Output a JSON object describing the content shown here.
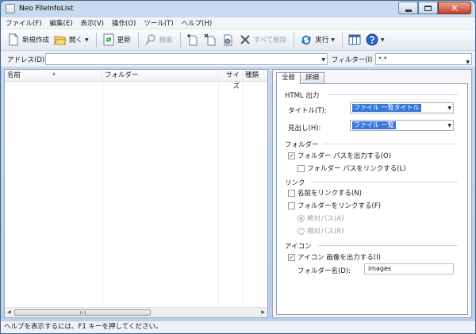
{
  "window": {
    "title": "Neo FileInfoList",
    "close_glyph": "✕"
  },
  "menu": [
    "ファイル(F)",
    "編集(E)",
    "表示(V)",
    "操作(O)",
    "ツール(T)",
    "ヘルプ(H)"
  ],
  "toolbar": {
    "new_label": "新規作成",
    "open_label": "開く",
    "refresh_label": "更新",
    "search_label": "検索",
    "delete_all_label": "すべて削除",
    "run_label": "実行",
    "caret": "▼"
  },
  "address": {
    "label": "アドレス(D)",
    "value": "",
    "arrow": "▼"
  },
  "filter": {
    "label": "フィルター(I)",
    "value": "*.*",
    "arrow": "▼"
  },
  "list": {
    "columns": [
      "名前",
      "フォルダー",
      "サイズ",
      "種類"
    ],
    "sort_caret": "▲",
    "left_arrow": "◀",
    "right_arrow": "▶"
  },
  "tabs": [
    "全般",
    "詳細"
  ],
  "html_output": {
    "group_label": "HTML 出力",
    "title_label": "タイトル(T):",
    "title_value": "ファイル 一覧タイトル",
    "heading_label": "見出し(H):",
    "heading_value": "ファイル 一覧",
    "arrow": "▼"
  },
  "folder": {
    "group_label": "フォルダー",
    "output_path_label": "フォルダー パスを出力する(O)",
    "output_path_checked": true,
    "link_path_label": "フォルダー パスをリンクする(L)",
    "link_path_checked": false
  },
  "link": {
    "group_label": "リンク",
    "link_name_label": "名前をリンクする(N)",
    "link_name_checked": false,
    "link_folder_label": "フォルダーをリンクする(F)",
    "link_folder_checked": false,
    "absolute_label": "絶対パス(A)",
    "relative_label": "相対パス(R)"
  },
  "icon": {
    "group_label": "アイコン",
    "output_image_label": "アイコン 画像を出力する(I)",
    "output_image_checked": true,
    "folder_name_label": "フォルダー名(D):",
    "folder_name_value": "images"
  },
  "check_mark": "✓",
  "status": {
    "text": "ヘルプを表示するには、F1 キーを押してください。"
  },
  "colors": {
    "selection": "#3a78d8",
    "title_bar": "#c9daf0",
    "close_button": "#c7412b"
  }
}
